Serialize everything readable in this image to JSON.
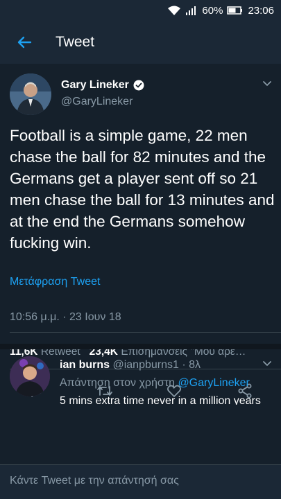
{
  "status_bar": {
    "battery": "60%",
    "time": "23:06"
  },
  "app_bar": {
    "title": "Tweet",
    "icons": [
      "back-arrow-icon"
    ]
  },
  "tweet": {
    "author_name": "Gary Lineker",
    "author_handle": "@GaryLineker",
    "text": "Football is a simple game, 22 men chase the ball for 82 minutes and the Germans get a player sent off so 21 men chase the ball for 13 minutes and at the end the Germans somehow fucking win.",
    "translate_label": "Μετάφραση Tweet",
    "timestamp": "10:56 μ.μ. · 23 Ιουν 18",
    "retweet_count": "11,6K",
    "retweet_label": "Retweet",
    "like_count": "23,4K",
    "like_label": "Επισημάνσεις \"Μου αρέ…",
    "actions": [
      "reply-icon",
      "retweet-icon",
      "like-icon",
      "share-icon"
    ]
  },
  "reply": {
    "name": "ian burns",
    "handle_time": "@ianpburns1 · 8λ",
    "reply_to_prefix": "Απάντηση στον χρήστη",
    "reply_to_mention": "@GaryLineker",
    "text": "5 mins extra time never in a million years"
  },
  "compose": {
    "placeholder": "Κάντε Tweet με την απάντησή σας"
  },
  "colors": {
    "background": "#15202b",
    "bar": "#1b2836",
    "accent": "#1da1f2",
    "muted": "#8899a6"
  }
}
